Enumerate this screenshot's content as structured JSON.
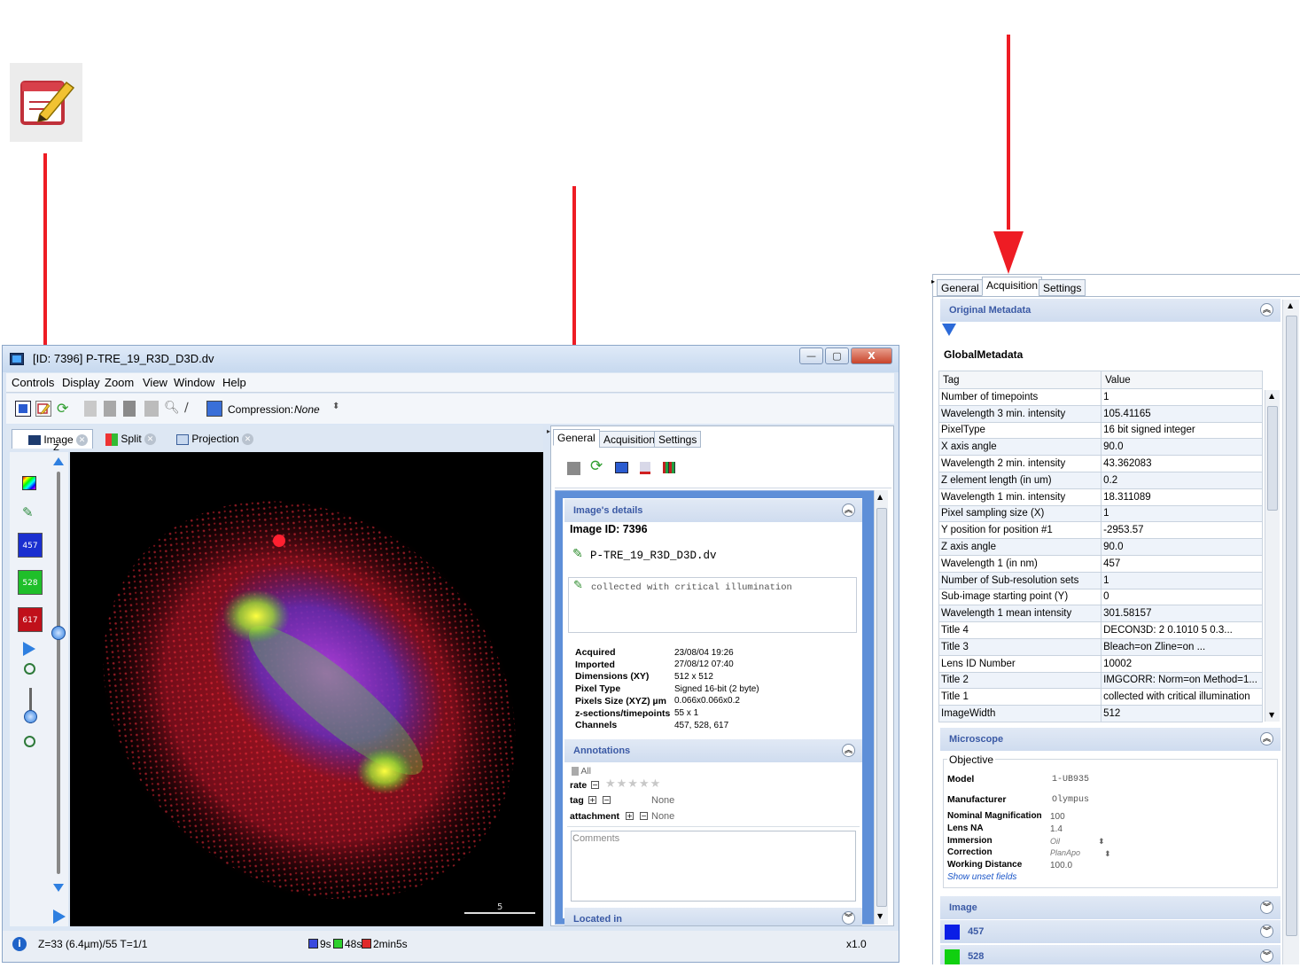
{
  "main_window": {
    "title": "[ID: 7396] P-TRE_19_R3D_D3D.dv",
    "minimize": "—",
    "maximize": "▢",
    "close": "X",
    "menu": [
      "Controls",
      "Display",
      "Zoom",
      "View",
      "Window",
      "Help"
    ],
    "toolbar": {
      "compression_label": "Compression:",
      "compression_value": "None"
    },
    "view_tabs": [
      "Image",
      "Split",
      "Projection"
    ],
    "z_label": "Z",
    "channels": [
      {
        "label": "457",
        "color": "#1a2fd0"
      },
      {
        "label": "528",
        "color": "#1fbf2a"
      },
      {
        "label": "617",
        "color": "#c0101a"
      }
    ],
    "scale_bar_label": "5",
    "status": {
      "position": "Z=33 (6.4µm)/55 T=1/1",
      "timings": [
        "9s",
        "48s",
        "2min5s"
      ],
      "zoom": "x1.0"
    }
  },
  "general_panel": {
    "tabs": [
      "General",
      "Acquisition",
      "Settings"
    ],
    "image_details": {
      "header": "Image's details",
      "image_id": "Image ID: 7396",
      "name": "P-TRE_19_R3D_D3D.dv",
      "description": "collected with critical illumination",
      "fields": [
        {
          "label": "Acquired",
          "value": "23/08/04 19:26"
        },
        {
          "label": "Imported",
          "value": "27/08/12 07:40"
        },
        {
          "label": "Dimensions (XY)",
          "value": "512 x 512"
        },
        {
          "label": "Pixel Type",
          "value": "Signed 16-bit (2 byte)"
        },
        {
          "label": "Pixels Size (XYZ) µm",
          "value": "0.066x0.066x0.2"
        },
        {
          "label": "z-sections/timepoints",
          "value": "55 x 1"
        },
        {
          "label": "Channels",
          "value": "457, 528, 617"
        }
      ]
    },
    "annotations": {
      "header": "Annotations",
      "all": "All",
      "rate_label": "rate",
      "tag_label": "tag",
      "tag_value": "None",
      "attachment_label": "attachment",
      "attachment_value": "None",
      "comments_placeholder": "Comments"
    },
    "located_in": "Located in"
  },
  "acquisition_panel": {
    "tabs": [
      "General",
      "Acquisition",
      "Settings"
    ],
    "original_metadata_header": "Original Metadata",
    "global_metadata_title": "GlobalMetadata",
    "table_headers": [
      "Tag",
      "Value"
    ],
    "rows": [
      [
        "Number of timepoints",
        "1"
      ],
      [
        "Wavelength 3 min. intensity",
        "105.41165"
      ],
      [
        "PixelType",
        "16 bit signed integer"
      ],
      [
        "X axis angle",
        "90.0"
      ],
      [
        "Wavelength 2 min. intensity",
        "43.362083"
      ],
      [
        "Z element length (in um)",
        "0.2"
      ],
      [
        "Wavelength 1 min. intensity",
        "18.311089"
      ],
      [
        "Pixel sampling size (X)",
        "1"
      ],
      [
        "Y position for position #1",
        "-2953.57"
      ],
      [
        "Z axis angle",
        "90.0"
      ],
      [
        "Wavelength 1 (in nm)",
        "457"
      ],
      [
        "Number of Sub-resolution sets",
        "1"
      ],
      [
        "Sub-image starting point (Y)",
        "0"
      ],
      [
        "Wavelength 1 mean intensity",
        "301.58157"
      ],
      [
        "Title 4",
        "DECON3D:  2    0.1010    5    0.3..."
      ],
      [
        "Title 3",
        "            Bleach=on  Zline=on          ..."
      ],
      [
        "Lens ID Number",
        "10002"
      ],
      [
        "Title 2",
        "IMGCORR:  Norm=on  Method=1..."
      ],
      [
        "Title 1",
        "collected with critical illumination"
      ],
      [
        "ImageWidth",
        "512"
      ]
    ],
    "microscope": {
      "header": "Microscope",
      "objective_label": "Objective",
      "fields": [
        {
          "label": "Model",
          "value": "1-UB935"
        },
        {
          "label": "Manufacturer",
          "value": "Olympus"
        }
      ],
      "small_fields": [
        {
          "label": "Nominal Magnification",
          "value": "100"
        },
        {
          "label": "Lens NA",
          "value": "1.4"
        },
        {
          "label": "Immersion",
          "value": "Oil"
        },
        {
          "label": "Correction",
          "value": "PlanApo"
        },
        {
          "label": "Working Distance",
          "value": "100.0"
        }
      ],
      "show_unset": "Show unset fields"
    },
    "image_section": {
      "header": "Image",
      "channels": [
        {
          "label": "457",
          "color": "#0a1ee6"
        },
        {
          "label": "528",
          "color": "#10d010"
        }
      ]
    }
  },
  "colors": {
    "arrow": "#ee1c24",
    "section_header_text": "#3b5aa5",
    "window_frame": "#dbe6f4"
  }
}
